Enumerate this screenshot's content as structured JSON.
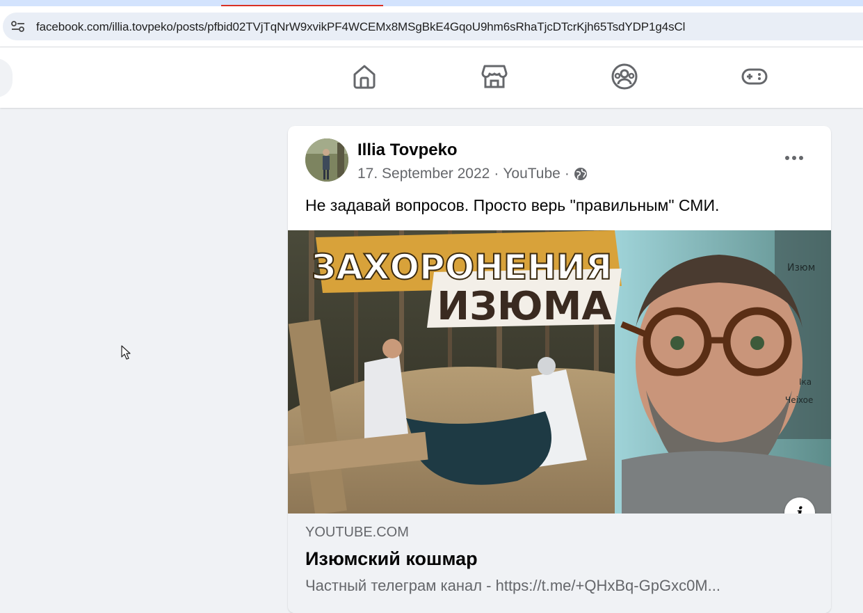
{
  "browser": {
    "url": "facebook.com/illia.tovpeko/posts/pfbid02TVjTqNrW9xvikPF4WCEMx8MSgBkE4GqoU9hm6sRhaTjcDTcrKjh65TsdYDP1g4sCl",
    "site_info_icon": "tune-icon"
  },
  "nav": {
    "icons": [
      "home-icon",
      "marketplace-icon",
      "groups-icon",
      "gaming-icon"
    ]
  },
  "post": {
    "author": "Illia Tovpeko",
    "date": "17. September 2022",
    "separator": "·",
    "source": "YouTube",
    "privacy_icon": "globe-icon",
    "text": "Не задавай вопросов. Просто верь \"правильным\" СМИ.",
    "thumbnail": {
      "headline_line1": "ЗАХОРОНЕНИЯ",
      "headline_line2": "ИЗЮМА",
      "map_labels": [
        "Изюм",
        "Іка",
        "Чеixoe"
      ]
    },
    "info_symbol": "i",
    "link": {
      "domain": "YOUTUBE.COM",
      "title": "Изюмский кошмар",
      "description": "Частный телеграм канал - https://t.me/+QHxBq-GpGxc0M..."
    }
  },
  "colors": {
    "page_bg": "#f0f2f5",
    "card_bg": "#ffffff",
    "text_primary": "#050505",
    "text_secondary": "#65676b",
    "tab_accent": "#d93025"
  }
}
